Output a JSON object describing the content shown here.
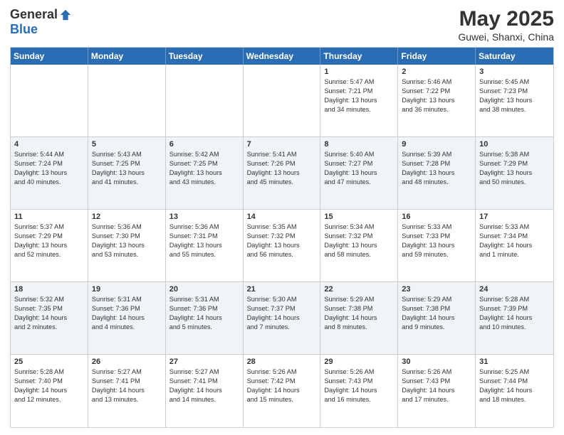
{
  "logo": {
    "general": "General",
    "blue": "Blue"
  },
  "title": "May 2025",
  "location": "Guwei, Shanxi, China",
  "day_headers": [
    "Sunday",
    "Monday",
    "Tuesday",
    "Wednesday",
    "Thursday",
    "Friday",
    "Saturday"
  ],
  "weeks": [
    [
      {
        "num": "",
        "info": ""
      },
      {
        "num": "",
        "info": ""
      },
      {
        "num": "",
        "info": ""
      },
      {
        "num": "",
        "info": ""
      },
      {
        "num": "1",
        "info": "Sunrise: 5:47 AM\nSunset: 7:21 PM\nDaylight: 13 hours\nand 34 minutes."
      },
      {
        "num": "2",
        "info": "Sunrise: 5:46 AM\nSunset: 7:22 PM\nDaylight: 13 hours\nand 36 minutes."
      },
      {
        "num": "3",
        "info": "Sunrise: 5:45 AM\nSunset: 7:23 PM\nDaylight: 13 hours\nand 38 minutes."
      }
    ],
    [
      {
        "num": "4",
        "info": "Sunrise: 5:44 AM\nSunset: 7:24 PM\nDaylight: 13 hours\nand 40 minutes."
      },
      {
        "num": "5",
        "info": "Sunrise: 5:43 AM\nSunset: 7:25 PM\nDaylight: 13 hours\nand 41 minutes."
      },
      {
        "num": "6",
        "info": "Sunrise: 5:42 AM\nSunset: 7:25 PM\nDaylight: 13 hours\nand 43 minutes."
      },
      {
        "num": "7",
        "info": "Sunrise: 5:41 AM\nSunset: 7:26 PM\nDaylight: 13 hours\nand 45 minutes."
      },
      {
        "num": "8",
        "info": "Sunrise: 5:40 AM\nSunset: 7:27 PM\nDaylight: 13 hours\nand 47 minutes."
      },
      {
        "num": "9",
        "info": "Sunrise: 5:39 AM\nSunset: 7:28 PM\nDaylight: 13 hours\nand 48 minutes."
      },
      {
        "num": "10",
        "info": "Sunrise: 5:38 AM\nSunset: 7:29 PM\nDaylight: 13 hours\nand 50 minutes."
      }
    ],
    [
      {
        "num": "11",
        "info": "Sunrise: 5:37 AM\nSunset: 7:29 PM\nDaylight: 13 hours\nand 52 minutes."
      },
      {
        "num": "12",
        "info": "Sunrise: 5:36 AM\nSunset: 7:30 PM\nDaylight: 13 hours\nand 53 minutes."
      },
      {
        "num": "13",
        "info": "Sunrise: 5:36 AM\nSunset: 7:31 PM\nDaylight: 13 hours\nand 55 minutes."
      },
      {
        "num": "14",
        "info": "Sunrise: 5:35 AM\nSunset: 7:32 PM\nDaylight: 13 hours\nand 56 minutes."
      },
      {
        "num": "15",
        "info": "Sunrise: 5:34 AM\nSunset: 7:32 PM\nDaylight: 13 hours\nand 58 minutes."
      },
      {
        "num": "16",
        "info": "Sunrise: 5:33 AM\nSunset: 7:33 PM\nDaylight: 13 hours\nand 59 minutes."
      },
      {
        "num": "17",
        "info": "Sunrise: 5:33 AM\nSunset: 7:34 PM\nDaylight: 14 hours\nand 1 minute."
      }
    ],
    [
      {
        "num": "18",
        "info": "Sunrise: 5:32 AM\nSunset: 7:35 PM\nDaylight: 14 hours\nand 2 minutes."
      },
      {
        "num": "19",
        "info": "Sunrise: 5:31 AM\nSunset: 7:36 PM\nDaylight: 14 hours\nand 4 minutes."
      },
      {
        "num": "20",
        "info": "Sunrise: 5:31 AM\nSunset: 7:36 PM\nDaylight: 14 hours\nand 5 minutes."
      },
      {
        "num": "21",
        "info": "Sunrise: 5:30 AM\nSunset: 7:37 PM\nDaylight: 14 hours\nand 7 minutes."
      },
      {
        "num": "22",
        "info": "Sunrise: 5:29 AM\nSunset: 7:38 PM\nDaylight: 14 hours\nand 8 minutes."
      },
      {
        "num": "23",
        "info": "Sunrise: 5:29 AM\nSunset: 7:38 PM\nDaylight: 14 hours\nand 9 minutes."
      },
      {
        "num": "24",
        "info": "Sunrise: 5:28 AM\nSunset: 7:39 PM\nDaylight: 14 hours\nand 10 minutes."
      }
    ],
    [
      {
        "num": "25",
        "info": "Sunrise: 5:28 AM\nSunset: 7:40 PM\nDaylight: 14 hours\nand 12 minutes."
      },
      {
        "num": "26",
        "info": "Sunrise: 5:27 AM\nSunset: 7:41 PM\nDaylight: 14 hours\nand 13 minutes."
      },
      {
        "num": "27",
        "info": "Sunrise: 5:27 AM\nSunset: 7:41 PM\nDaylight: 14 hours\nand 14 minutes."
      },
      {
        "num": "28",
        "info": "Sunrise: 5:26 AM\nSunset: 7:42 PM\nDaylight: 14 hours\nand 15 minutes."
      },
      {
        "num": "29",
        "info": "Sunrise: 5:26 AM\nSunset: 7:43 PM\nDaylight: 14 hours\nand 16 minutes."
      },
      {
        "num": "30",
        "info": "Sunrise: 5:26 AM\nSunset: 7:43 PM\nDaylight: 14 hours\nand 17 minutes."
      },
      {
        "num": "31",
        "info": "Sunrise: 5:25 AM\nSunset: 7:44 PM\nDaylight: 14 hours\nand 18 minutes."
      }
    ]
  ]
}
